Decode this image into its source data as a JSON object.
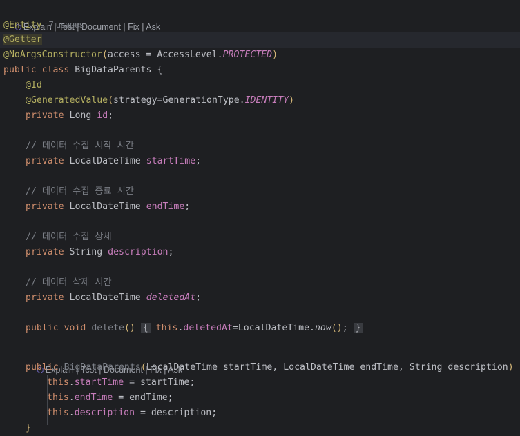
{
  "ai_hint": {
    "icon": "ai-assistant-icon",
    "text": "Explain | Test | Document | Fix | Ask"
  },
  "ai_hint_2": {
    "icon": "ai-assistant-icon",
    "text": "Explain | Test | Document | Fix | Ask"
  },
  "code": {
    "entity": "@Entity",
    "entity_usages": "7 usages",
    "getter": "@Getter",
    "noargs": "@NoArgsConstructor",
    "access_arg": "access = AccessLevel.",
    "access_const": "PROTECTED",
    "public_kw": "public",
    "class_kw": "class",
    "class_name": "BigDataParents {",
    "id_ann": "@Id",
    "genval_ann": "@GeneratedValue",
    "strategy_arg": "strategy=GenerationType.",
    "identity_const": "IDENTITY",
    "private_kw": "private",
    "long_type": "Long",
    "id_field": "id",
    "comment_start": "// 데이터 수집 시작 시간",
    "ldt_type": "LocalDateTime",
    "start_field": "startTime",
    "comment_end": "// 데이터 수집 종료 시간",
    "end_field": "endTime",
    "comment_desc": "// 데이터 수집 상세",
    "string_type": "String",
    "desc_field": "description",
    "comment_deleted": "// 데이터 삭제 시간",
    "deleted_field": "deletedAt",
    "void_kw": "void",
    "delete_method": "delete",
    "this_kw": "this",
    "ldt_call": "=LocalDateTime.",
    "now_method": "now",
    "ctor_name": "BigDataParents",
    "ctor_params": "LocalDateTime startTime, LocalDateTime endTime, String description",
    "assign_start": " = startTime;",
    "assign_end": " = endTime;",
    "assign_desc": " = description;"
  }
}
